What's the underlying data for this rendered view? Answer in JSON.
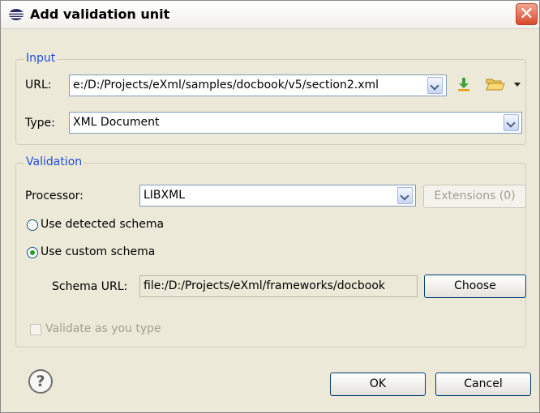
{
  "window": {
    "title": "Add validation unit",
    "close_glyph": "✕"
  },
  "input_group": {
    "legend": "Input",
    "url_label": "URL:",
    "url_value": "e:/D:/Projects/eXml/samples/docbook/v5/section2.xml",
    "type_label": "Type:",
    "type_value": "XML Document"
  },
  "validation_group": {
    "legend": "Validation",
    "processor_label": "Processor:",
    "processor_value": "LIBXML",
    "extensions_label": "Extensions (0)",
    "use_detected_label": "Use detected schema",
    "use_custom_label": "Use custom schema",
    "selected_option": "custom",
    "schema_url_label": "Schema URL:",
    "schema_url_value": "file:/D:/Projects/eXml/frameworks/docbook",
    "choose_label": "Choose",
    "validate_label": "Validate as you type"
  },
  "footer": {
    "help_glyph": "?",
    "ok_label": "OK",
    "cancel_label": "Cancel"
  },
  "icons": [
    "eclipse-logo-icon",
    "close-icon",
    "download-icon",
    "folder-open-icon",
    "chevron-down-icon",
    "help-icon"
  ],
  "colors": {
    "legend": "#1f4fd8",
    "dialog_bg": "#ece9d8",
    "close_button": "#d9492c"
  }
}
